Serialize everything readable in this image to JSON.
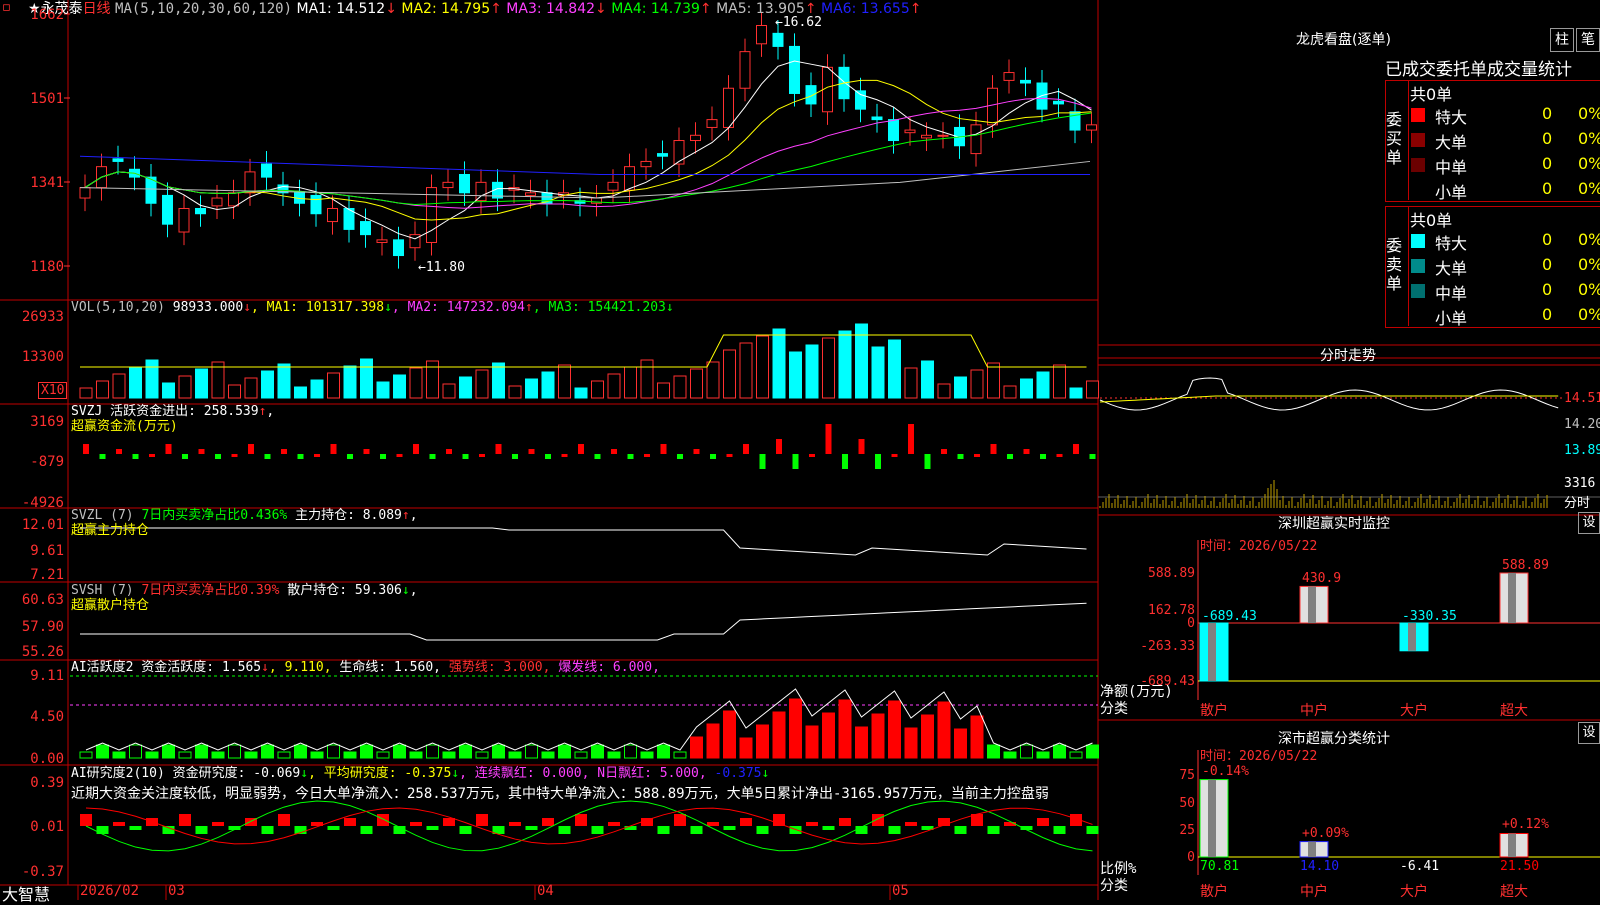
{
  "window": {
    "stock": "永茂泰",
    "period": "日线"
  },
  "kline": {
    "ma_params": "MA(5,10,20,30,60,120)",
    "ma": [
      {
        "label": "MA1:",
        "value": "14.512",
        "arrow": "↓",
        "color": "#ffffff"
      },
      {
        "label": "MA2:",
        "value": "14.795",
        "arrow": "↑",
        "color": "#ffff00"
      },
      {
        "label": "MA3:",
        "value": "14.842",
        "arrow": "↓",
        "color": "#ff40ff"
      },
      {
        "label": "MA4:",
        "value": "14.739",
        "arrow": "↑",
        "color": "#00ff00"
      },
      {
        "label": "MA5:",
        "value": "13.905",
        "arrow": "↑",
        "color": "#c0c0c0"
      },
      {
        "label": "MA6:",
        "value": "13.655",
        "arrow": "↑",
        "color": "#2020ff"
      }
    ],
    "y_ticks": [
      "1662",
      "1501",
      "1341",
      "1180"
    ],
    "high_label": "16.62",
    "low_label": "11.80",
    "high_arrow": "←",
    "low_arrow": "←"
  },
  "vol": {
    "params": "VOL(5,10,20)",
    "value": "98933.000",
    "arrow": "↓",
    "ma": [
      {
        "label": "MA1:",
        "value": "101317.398",
        "arrow": "↓",
        "color": "#ffff00"
      },
      {
        "label": "MA2:",
        "value": "147232.094",
        "arrow": "↑",
        "color": "#ff40ff"
      },
      {
        "label": "MA3:",
        "value": "154421.203",
        "arrow": "↓",
        "color": "#00ff00"
      }
    ],
    "y_ticks": [
      "26933",
      "13300"
    ],
    "unit": "X10"
  },
  "svzj": {
    "name": "SVZJ",
    "label": "活跃资金进出:",
    "value": "258.539",
    "arrow": "↑",
    "sub": "超赢资金流(万元)",
    "y_ticks": [
      "3169",
      "-879",
      "-4926"
    ]
  },
  "svzl": {
    "name": "SVZL (7)",
    "pct_label": "7日内买卖净占比0.436%",
    "main_label": "主力持仓:",
    "main_value": "8.089",
    "arrow": "↑",
    "sub": "超赢主力持仓",
    "y_ticks": [
      "12.01",
      "9.61",
      "7.21"
    ]
  },
  "svsh": {
    "name": "SVSH (7)",
    "pct_label": "7日内买卖净占比0.39%",
    "main_label": "散户持仓:",
    "main_value": "59.306",
    "arrow": "↓",
    "sub": "超赢散户持仓",
    "y_ticks": [
      "60.63",
      "57.90",
      "55.26"
    ]
  },
  "ai_active": {
    "name": "AI活跃度2",
    "l1": "资金活跃度:",
    "v1": "1.565",
    "a1": "↓",
    "v1b": "9.110",
    "l2": "生命线:",
    "v2": "1.560",
    "l3": "强势线:",
    "v3": "3.000",
    "l4": "爆发线:",
    "v4": "6.000",
    "y_ticks": [
      "9.11",
      "4.50",
      "0.00"
    ]
  },
  "ai_research": {
    "name": "AI研究度2(10)",
    "l1": "资金研究度:",
    "v1": "-0.069",
    "a1": "↓",
    "l2": "平均研究度:",
    "v2": "-0.375",
    "a2": "↓",
    "l3": "连续飘红:",
    "v3": "0.000",
    "l4": "N日飘红:",
    "v4": "5.000",
    "v5": "-0.375",
    "a5": "↓",
    "text": "近期大资金关注度较低，明显弱势，今日大单净流入：258.537万元，其中特大单净流入：588.89万元，大单5日累计净出-3165.957万元，当前主力控盘弱",
    "y_ticks": [
      "0.39",
      "0.01",
      "-0.37"
    ]
  },
  "xaxis": {
    "brand": "大智慧",
    "labels": [
      "2026/02",
      "03",
      "04",
      "05"
    ]
  },
  "lhb": {
    "title": "龙虎看盘(逐单)",
    "btn1": "柱",
    "btn2": "笔",
    "header": "已成交委托单成交量统计",
    "buy_side": "委买单",
    "sell_side": "委卖单",
    "count_label": "共0单",
    "rows": [
      {
        "name": "特大",
        "value": "0",
        "pct": "0%"
      },
      {
        "name": "大单",
        "value": "0",
        "pct": "0%"
      },
      {
        "name": "中单",
        "value": "0",
        "pct": "0%"
      },
      {
        "name": "小单",
        "value": "0",
        "pct": "0%"
      }
    ],
    "buy_colors": [
      "#ff0000",
      "#8b0000",
      "#6b0000",
      "#000000"
    ],
    "sell_colors": [
      "#00ffff",
      "#008b8b",
      "#007070",
      "#000000"
    ]
  },
  "intraday": {
    "title": "分时走势",
    "prices": [
      "14.51",
      "14.20",
      "13.89"
    ],
    "vol": "3316",
    "vol_unit": "分时"
  },
  "sz_monitor": {
    "title": "深圳超赢实时监控",
    "btn": "设",
    "time_label": "时间：",
    "time": "2026/05/22",
    "y_ticks": [
      "588.89",
      "162.78",
      "0",
      "-263.33",
      "-689.43"
    ],
    "unit": "净额(万元)",
    "cat_label": "分类",
    "cats": [
      "散户",
      "中户",
      "大户",
      "超大"
    ],
    "chart_data": {
      "type": "bar",
      "categories": [
        "散户",
        "中户",
        "大户",
        "超大"
      ],
      "values": [
        -689.43,
        430.9,
        -330.35,
        588.89
      ],
      "value_labels": [
        "-689.43",
        "430.9",
        "-330.35",
        "588.89"
      ],
      "ylim": [
        -689.43,
        588.89
      ]
    }
  },
  "sh_stats": {
    "title": "深市超赢分类统计",
    "btn": "设",
    "time_label": "时间：",
    "time": "2026/05/22",
    "y_ticks": [
      "75",
      "50",
      "25",
      "0"
    ],
    "unit": "比例%",
    "cat_label": "分类",
    "cats": [
      "散户",
      "中户",
      "大户",
      "超大"
    ],
    "chart_data": {
      "type": "bar",
      "categories": [
        "散户",
        "中户",
        "大户",
        "超大"
      ],
      "values": [
        70.81,
        14.1,
        -6.41,
        21.5
      ],
      "changes": [
        "-0.14%",
        "+0.09%",
        "",
        "+0.12%"
      ],
      "value_labels": [
        "70.81",
        "14.10",
        "-6.41",
        "21.50"
      ],
      "ylim": [
        0,
        75
      ]
    }
  }
}
